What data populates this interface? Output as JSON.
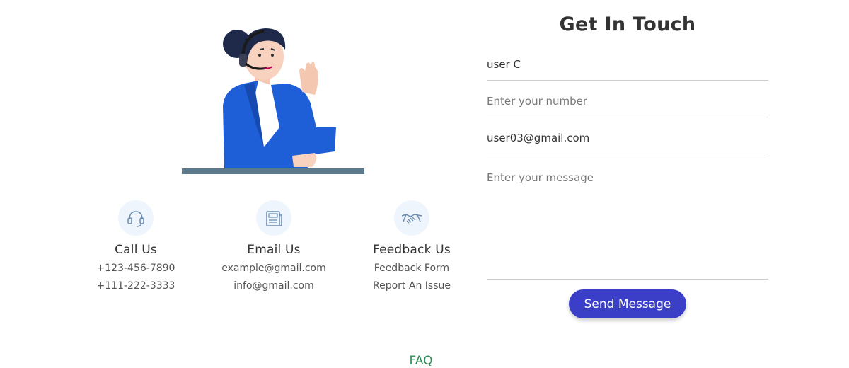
{
  "form": {
    "title": "Get In Touch",
    "name_value": "user C",
    "number_placeholder": "Enter your number",
    "email_value": "user03@gmail.com",
    "message_placeholder": "Enter your message",
    "send_label": "Send Message"
  },
  "contacts": [
    {
      "title": "Call Us",
      "icon": "headset-icon",
      "lines": [
        "+123-456-7890",
        "+111-222-3333"
      ]
    },
    {
      "title": "Email Us",
      "icon": "newspaper-icon",
      "lines": [
        "example@gmail.com",
        "info@gmail.com"
      ]
    },
    {
      "title": "Feedback Us",
      "icon": "handshake-icon",
      "lines": [
        "Feedback Form",
        "Report An Issue"
      ]
    }
  ],
  "footer": {
    "faq_label": "FAQ"
  },
  "colors": {
    "accent": "#3b3fc8",
    "icon_bg": "#eef5fc",
    "link": "#2e8b57",
    "jacket": "#1e5fd8"
  }
}
